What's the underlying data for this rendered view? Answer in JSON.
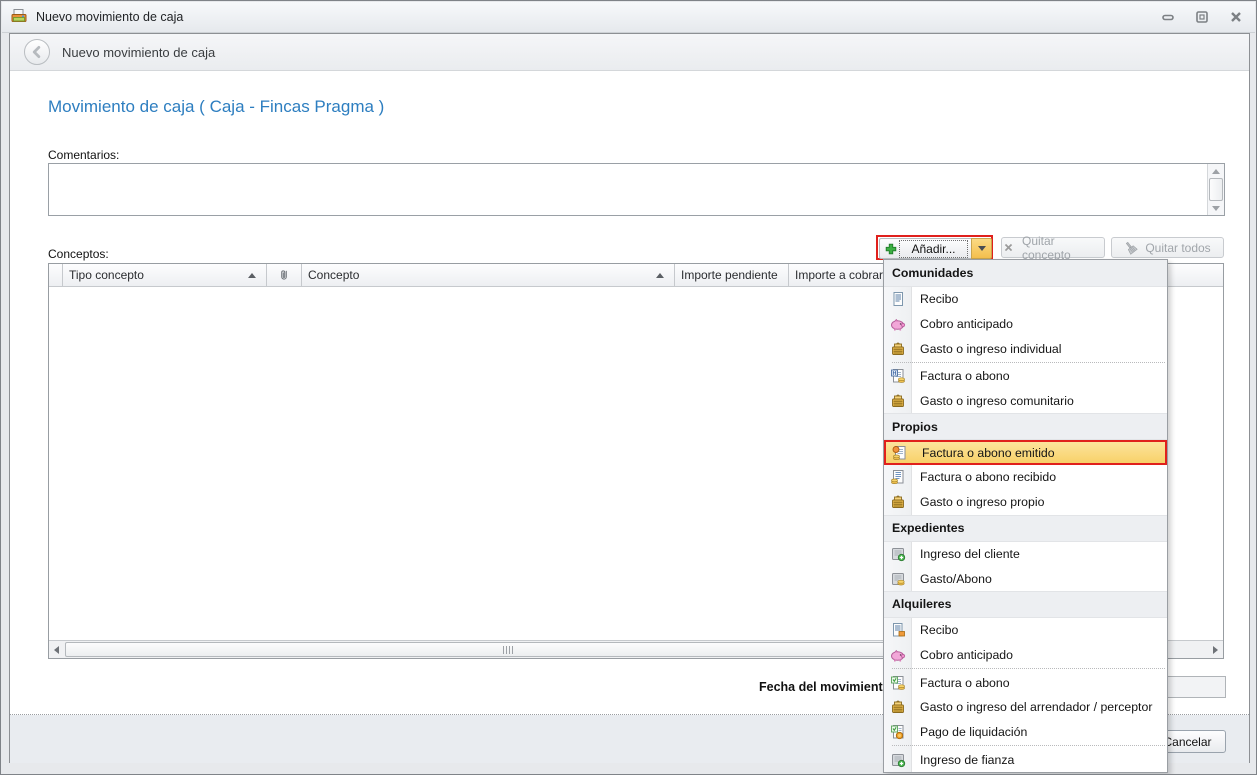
{
  "window": {
    "title": "Nuevo movimiento de caja",
    "controls": [
      "minimize",
      "maximize",
      "close"
    ]
  },
  "banner": {
    "title": "Nuevo movimiento de caja"
  },
  "page": {
    "heading": "Movimiento de caja ( Caja - Fincas Pragma )"
  },
  "form": {
    "comments_label": "Comentarios:",
    "comments_value": "",
    "concepts_label": "Conceptos:",
    "date_label": "Fecha del movimiento",
    "date_value": ""
  },
  "toolbar": {
    "add_label": "Añadir...",
    "remove_label": "Quitar concepto",
    "remove_all_label": "Quitar todos"
  },
  "table": {
    "columns": [
      "Tipo concepto",
      "Concepto",
      "Importe pendiente",
      "Importe a cobrar ("
    ]
  },
  "menu": {
    "sections": [
      {
        "title": "Comunidades",
        "items": [
          {
            "label": "Recibo",
            "icon": "receipt"
          },
          {
            "label": "Cobro anticipado",
            "icon": "piggy-bank"
          },
          {
            "label": "Gasto o ingreso individual",
            "icon": "cash-box",
            "separator_after": true
          },
          {
            "label": "Factura o abono",
            "icon": "invoice-h"
          },
          {
            "label": "Gasto o ingreso comunitario",
            "icon": "cash-box"
          }
        ]
      },
      {
        "title": "Propios",
        "items": [
          {
            "label": "Factura o abono emitido",
            "icon": "invoice-emitted",
            "highlighted": true
          },
          {
            "label": "Factura o abono recibido",
            "icon": "invoice-received"
          },
          {
            "label": "Gasto o ingreso propio",
            "icon": "cash-box"
          }
        ]
      },
      {
        "title": "Expedientes",
        "items": [
          {
            "label": "Ingreso del cliente",
            "icon": "card-plus"
          },
          {
            "label": "Gasto/Abono",
            "icon": "card-coins"
          }
        ]
      },
      {
        "title": "Alquileres",
        "items": [
          {
            "label": "Recibo",
            "icon": "receipt-orange"
          },
          {
            "label": "Cobro anticipado",
            "icon": "piggy-bank",
            "separator_after": true
          },
          {
            "label": "Factura o abono",
            "icon": "invoice-v"
          },
          {
            "label": "Gasto o ingreso del arrendador / perceptor",
            "icon": "cash-box"
          },
          {
            "label": "Pago de liquidación",
            "icon": "invoice-settle",
            "separator_after": true
          },
          {
            "label": "Ingreso de fianza",
            "icon": "card-plus"
          }
        ]
      }
    ]
  },
  "footer": {
    "cancel_label": "Cancelar"
  },
  "colors": {
    "heading_blue": "#2d7ec0",
    "annotation_red": "#e0201c",
    "menu_highlight_top": "#fce49c",
    "menu_highlight_bottom": "#f8d169",
    "add_arrow_top": "#fbda84",
    "add_arrow_bottom": "#f4bf4e",
    "footer_bg": "#e9ecf0"
  }
}
